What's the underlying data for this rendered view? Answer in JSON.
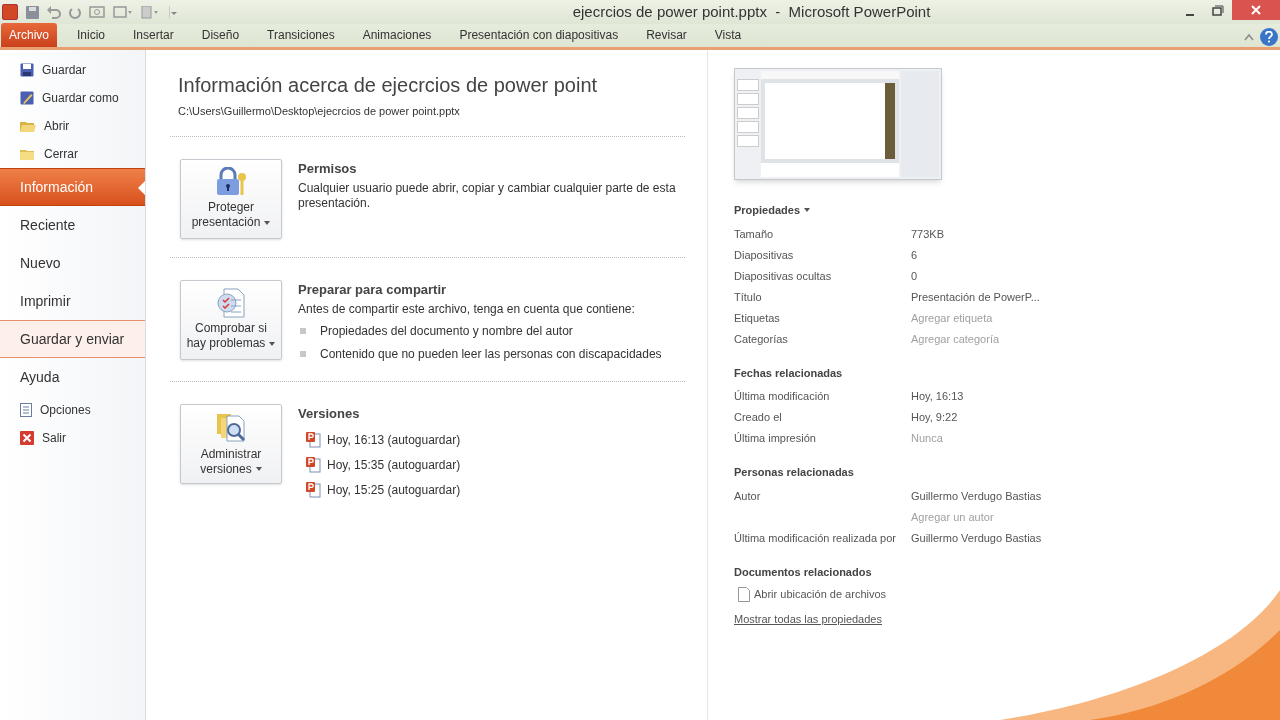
{
  "window": {
    "title": "ejecrcios de power point.pptx  -  Microsoft PowerPoint"
  },
  "ribbon_tabs": [
    {
      "label": "Archivo",
      "selected": true
    },
    {
      "label": "Inicio",
      "selected": false
    },
    {
      "label": "Insertar",
      "selected": false
    },
    {
      "label": "Diseño",
      "selected": false
    },
    {
      "label": "Transiciones",
      "selected": false
    },
    {
      "label": "Animaciones",
      "selected": false
    },
    {
      "label": "Presentación con diapositivas",
      "selected": false
    },
    {
      "label": "Revisar",
      "selected": false
    },
    {
      "label": "Vista",
      "selected": false
    }
  ],
  "sidebar": {
    "items": [
      {
        "kind": "command",
        "label": "Guardar",
        "selected": false,
        "hovered": false
      },
      {
        "kind": "command",
        "label": "Guardar como",
        "selected": false,
        "hovered": false
      },
      {
        "kind": "command",
        "label": "Abrir",
        "selected": false,
        "hovered": false
      },
      {
        "kind": "command",
        "label": "Cerrar",
        "selected": false,
        "hovered": false
      },
      {
        "kind": "section",
        "label": "Información",
        "selected": true,
        "hovered": false
      },
      {
        "kind": "section",
        "label": "Reciente",
        "selected": false,
        "hovered": false
      },
      {
        "kind": "section",
        "label": "Nuevo",
        "selected": false,
        "hovered": false
      },
      {
        "kind": "section",
        "label": "Imprimir",
        "selected": false,
        "hovered": false
      },
      {
        "kind": "section",
        "label": "Guardar y enviar",
        "selected": false,
        "hovered": true
      },
      {
        "kind": "section",
        "label": "Ayuda",
        "selected": false,
        "hovered": false
      },
      {
        "kind": "command",
        "label": "Opciones",
        "selected": false,
        "hovered": false
      },
      {
        "kind": "command",
        "label": "Salir",
        "selected": false,
        "hovered": false
      }
    ]
  },
  "info": {
    "title": "Información acerca de ejecrcios de power point",
    "path": "C:\\Users\\Guillermo\\Desktop\\ejecrcios de power point.pptx",
    "sections": [
      {
        "kind": "permissions",
        "button": [
          "Proteger",
          "presentación"
        ],
        "heading": "Permisos",
        "text": "Cualquier usuario puede abrir, copiar y cambiar cualquier parte de esta presentación."
      },
      {
        "kind": "inspect",
        "button": [
          "Comprobar si",
          "hay problemas"
        ],
        "heading": "Preparar para compartir",
        "text": "Antes de compartir este archivo, tenga en cuenta que contiene:",
        "bullets": [
          "Propiedades del documento y nombre del autor",
          "Contenido que no pueden leer las personas con discapacidades"
        ]
      },
      {
        "kind": "versions",
        "button": [
          "Administrar",
          "versiones"
        ],
        "heading": "Versiones",
        "versions": [
          "Hoy, 16:13 (autoguardar)",
          "Hoy, 15:35 (autoguardar)",
          "Hoy, 15:25 (autoguardar)"
        ]
      }
    ]
  },
  "properties": {
    "heading": "Propiedades",
    "groups": [
      {
        "rows": [
          {
            "label": "Tamaño",
            "values": [
              {
                "text": "773KB",
                "muted": false
              }
            ]
          },
          {
            "label": "Diapositivas",
            "values": [
              {
                "text": "6",
                "muted": false
              }
            ]
          },
          {
            "label": "Diapositivas ocultas",
            "values": [
              {
                "text": "0",
                "muted": false
              }
            ]
          },
          {
            "label": "Título",
            "values": [
              {
                "text": "Presentación de PowerP...",
                "muted": false
              }
            ]
          },
          {
            "label": "Etiquetas",
            "values": [
              {
                "text": "Agregar etiqueta",
                "muted": true
              }
            ]
          },
          {
            "label": "Categorías",
            "values": [
              {
                "text": "Agregar categoría",
                "muted": true
              }
            ]
          }
        ]
      },
      {
        "heading": "Fechas relacionadas",
        "rows": [
          {
            "label": "Última modificación",
            "values": [
              {
                "text": "Hoy, 16:13",
                "muted": false
              }
            ]
          },
          {
            "label": "Creado el",
            "values": [
              {
                "text": "Hoy, 9:22",
                "muted": false
              }
            ]
          },
          {
            "label": "Última impresión",
            "values": [
              {
                "text": "Nunca",
                "muted": true
              }
            ]
          }
        ]
      },
      {
        "heading": "Personas relacionadas",
        "rows": [
          {
            "label": "Autor",
            "values": [
              {
                "text": "Guillermo Verdugo Bastias",
                "muted": false
              },
              {
                "text": "Agregar un autor",
                "muted": true
              }
            ]
          },
          {
            "label": "Última modificación realizada por",
            "values": [
              {
                "text": "Guillermo Verdugo Bastias",
                "muted": false
              }
            ]
          }
        ]
      }
    ],
    "related_heading": "Documentos relacionados",
    "open_location": "Abrir ubicación de archivos",
    "show_all": "Mostrar todas las propiedades"
  }
}
